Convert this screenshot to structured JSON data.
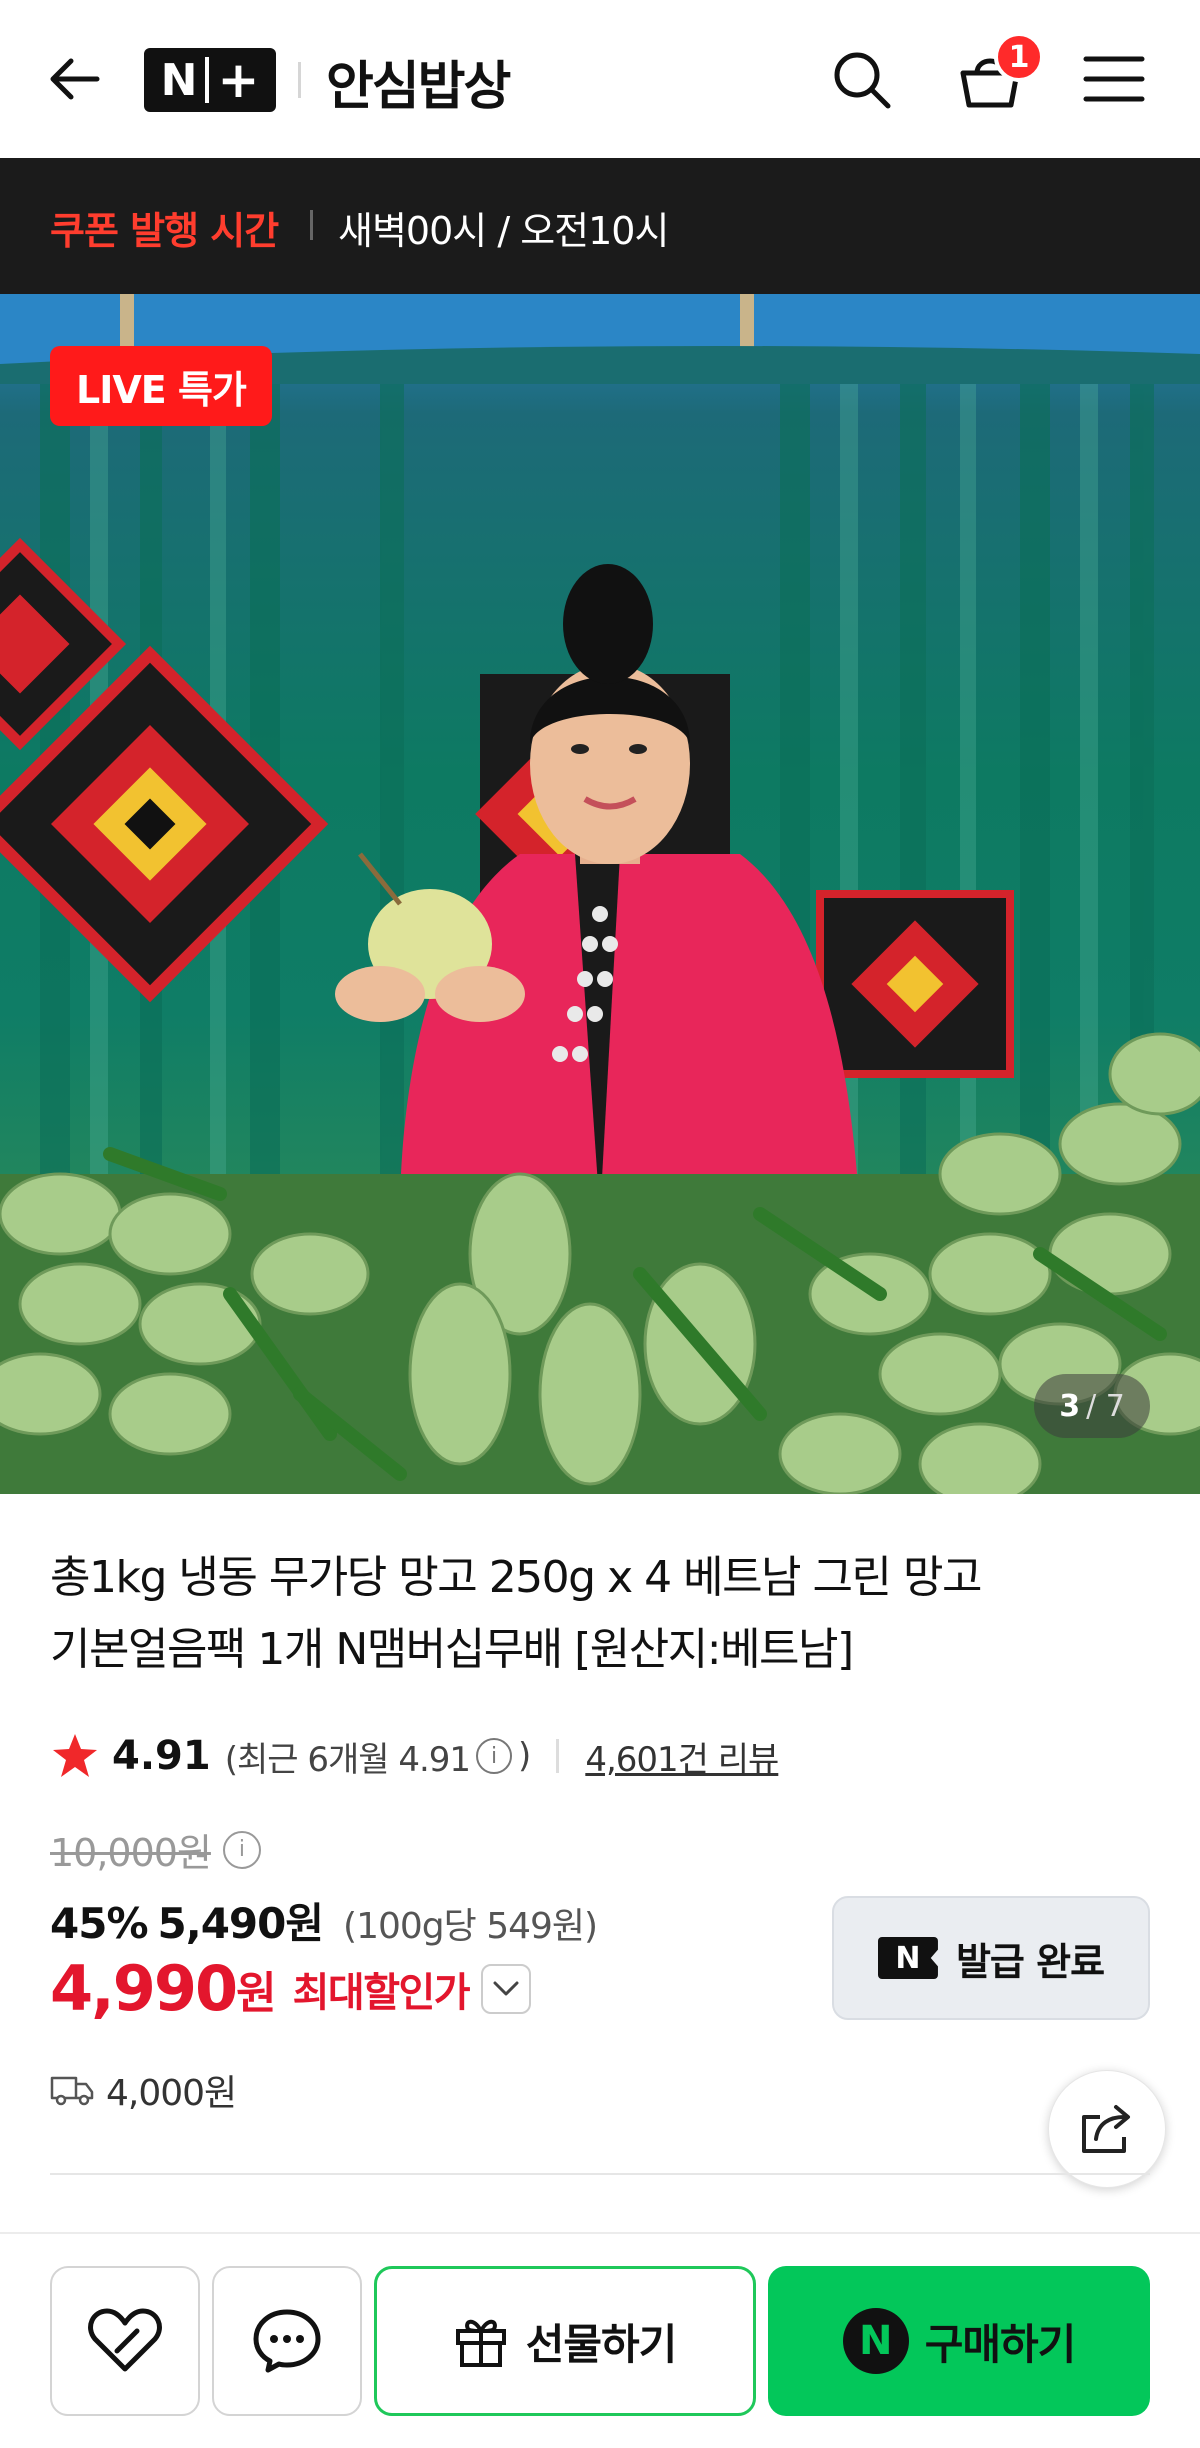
{
  "header": {
    "logo_n": "N",
    "logo_plus": "+",
    "store_name": "안심밥상",
    "cart_count": "1"
  },
  "coupon_bar": {
    "label": "쿠폰 발행 시간",
    "time": "새벽00시 / 오전10시"
  },
  "hero": {
    "live_badge": "LIVE 특가",
    "current_image": "3",
    "total_images": "/ 7"
  },
  "product": {
    "title_line1": "총1kg 냉동 무가당 망고 250g x 4 베트남 그린 망고",
    "title_line2": "기본얼음팩 1개 N맴버십무배 [원산지:베트남]",
    "rating": "4.91",
    "rating_recent": "(최근 6개월 4.91",
    "rating_recent_close": ")",
    "review_count": "4,601건 리뷰",
    "original_price": "10,000원",
    "discount_rate": "45%",
    "sale_price": "5,490원",
    "unit_price": "(100g당 549원)",
    "final_price": "4,990",
    "final_won": "원",
    "max_discount_label": "최대할인가",
    "coupon_badge": "N",
    "coupon_status": "발급 완료",
    "delivery_fee": "4,000원"
  },
  "bottom_bar": {
    "gift_label": "선물하기",
    "buy_badge": "N",
    "buy_label": "구매하기"
  },
  "colors": {
    "brand_green": "#03c75a",
    "sale_red": "#e3162d",
    "coupon_red": "#ff3d2e",
    "live_red": "#ff1a1a"
  }
}
